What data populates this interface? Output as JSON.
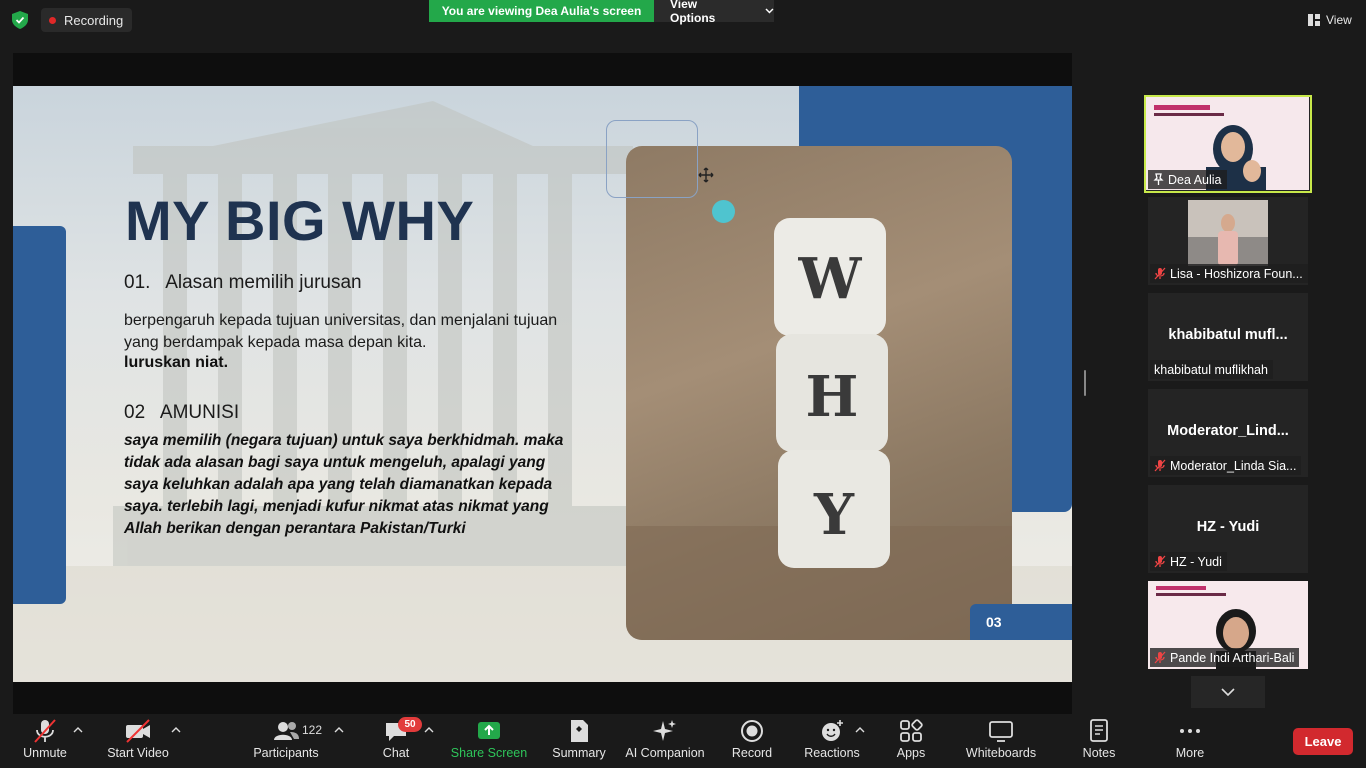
{
  "top": {
    "recording_label": "Recording",
    "viewing_banner": "You are viewing Dea Aulia's screen",
    "view_options_label": "View Options",
    "view_label": "View"
  },
  "slide": {
    "title": "MY BIG WHY",
    "item1_heading": "01.   Alasan memilih jurusan",
    "item1_text": "berpengaruh kepada tujuan universitas, dan menjalani tujuan yang berdampak kepada masa depan kita.",
    "item1_bold": "luruskan niat.",
    "item2_heading": "02   AMUNISI",
    "item2_text": "saya memilih (negara tujuan) untuk saya berkhidmah. maka tidak ada alasan bagi saya untuk mengeluh, apalagi yang saya keluhkan adalah apa yang telah diamanatkan kepada saya. terlebih lagi, menjadi kufur nikmat atas nikmat yang Allah berikan dengan perantara Pakistan/Turki",
    "dice_letters": [
      "W",
      "H",
      "Y"
    ],
    "page_number": "03"
  },
  "participants": [
    {
      "name": "Dea Aulia",
      "type": "video",
      "active": true
    },
    {
      "name": "Lisa - Hoshizora Foun...",
      "type": "video",
      "muted": true
    },
    {
      "name": "khabibatul muflikhah",
      "center": "khabibatul  mufl...",
      "type": "avatar",
      "muted": false
    },
    {
      "name": "Moderator_Linda Sia...",
      "center": "Moderator_Lind...",
      "type": "avatar",
      "muted": true
    },
    {
      "name": "HZ - Yudi",
      "center": "HZ - Yudi",
      "type": "avatar",
      "muted": true
    },
    {
      "name": "Pande Indi Arthari-Bali",
      "type": "video",
      "muted": true
    }
  ],
  "toolbar": {
    "unmute": "Unmute",
    "start_video": "Start Video",
    "participants": "Participants",
    "participants_count": "122",
    "chat": "Chat",
    "chat_badge": "50",
    "share_screen": "Share Screen",
    "summary": "Summary",
    "ai_companion": "AI Companion",
    "record": "Record",
    "reactions": "Reactions",
    "apps": "Apps",
    "whiteboards": "Whiteboards",
    "notes": "Notes",
    "more": "More",
    "leave": "Leave"
  },
  "colors": {
    "share_green": "#23a84a",
    "slide_blue": "#2e5e98",
    "active_border": "#c8e94a",
    "leave_red": "#d2292e",
    "badge_red": "#e23b3b"
  }
}
